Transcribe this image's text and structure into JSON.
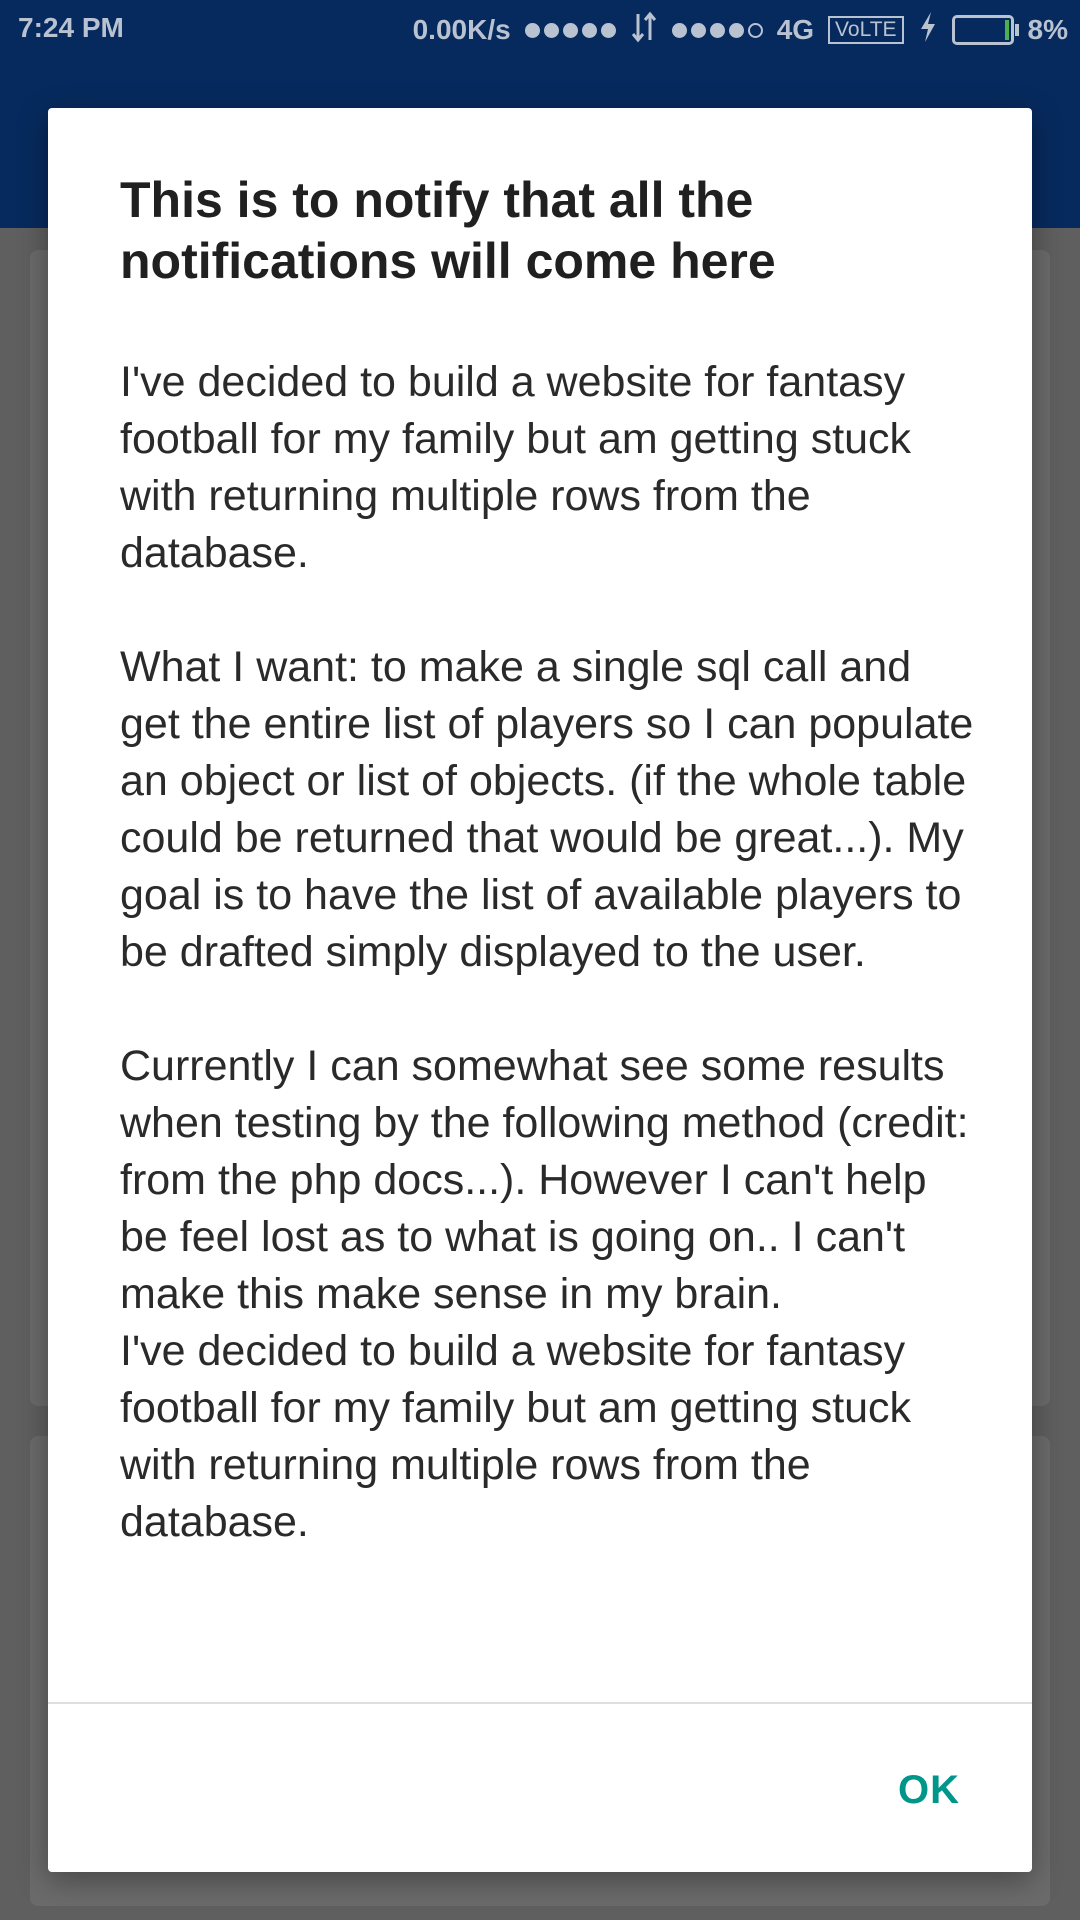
{
  "status_bar": {
    "time": "7:24 PM",
    "speed": "0.00K/s",
    "network": "4G",
    "volte": "VoLTE",
    "battery_percent": "8%",
    "battery_level": 0.08,
    "icons": [
      "signal-dots-icon",
      "data-arrows-icon",
      "volte-icon",
      "charging-icon",
      "battery-icon"
    ]
  },
  "dialog": {
    "title": "This is to notify that all the notifications will come here",
    "message": "I've decided to build a website for fantasy football for my family but am getting stuck with returning multiple rows from the database.\n\nWhat I want: to make a single sql call and get the entire list of players so I can populate an object or list of objects. (if the whole table could be returned that would be great...). My goal is to have the list of available players to be drafted simply displayed to the user.\n\nCurrently I can somewhat see some results when testing by the following method (credit: from the php docs...). However I can't help be feel lost as to what is going on.. I can't make this make sense in my brain.\nI've decided to build a website for fantasy football for my family but am getting stuck with returning multiple rows from the database.",
    "ok_label": "OK"
  },
  "colors": {
    "status_bar_bg": "#072a5e",
    "scrim": "#5f5f5f",
    "accent": "#00968a",
    "battery_fill": "#4caf50"
  }
}
